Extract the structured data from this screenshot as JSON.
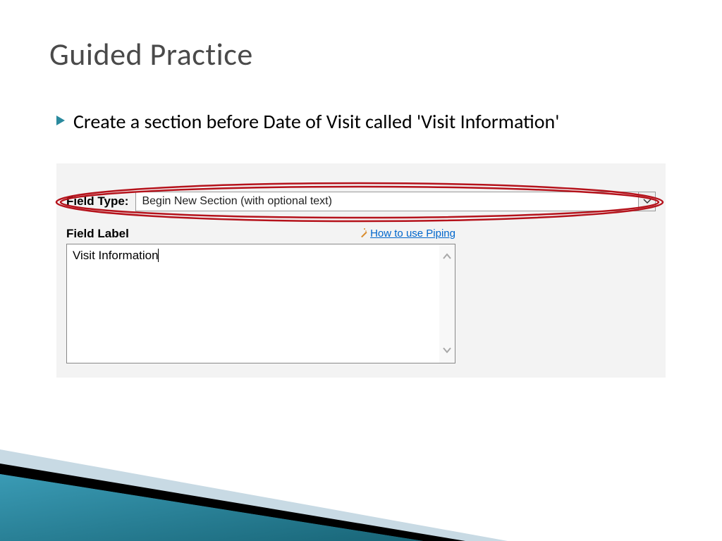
{
  "slide": {
    "title": "Guided Practice",
    "bullet_text": "Create a section before Date of Visit called 'Visit Information'"
  },
  "form": {
    "field_type_label": "Field Type:",
    "field_type_value": "Begin New Section (with optional text)",
    "field_label_text": "Field Label",
    "piping_link_text": "How to use Piping",
    "textarea_value": "Visit Information"
  }
}
